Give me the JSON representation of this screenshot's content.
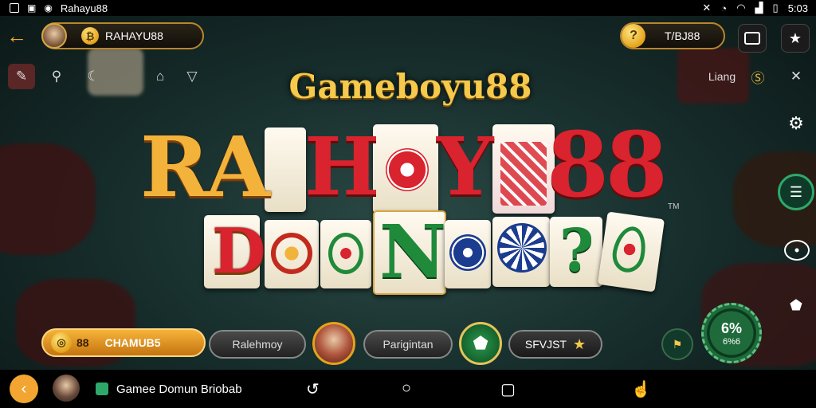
{
  "status": {
    "app_label": "Rahayu88",
    "time": "5:03"
  },
  "header": {
    "account_name": "RAHAYU88",
    "coin_symbol": "₿",
    "balance": "T/BJ88"
  },
  "toolbar": {
    "lang_label": "Liang"
  },
  "logo": {
    "top_title": "Gameboyu88",
    "row1_left": "RA",
    "row1_mid": "H",
    "row1_y": "Y",
    "row1_num": "88",
    "tm": "TM",
    "row2_d": "D",
    "row2_n": "N",
    "row2_q": "?"
  },
  "bottom": {
    "main_btn": "CHAMUB5",
    "main_num": "88",
    "btn2": "Ralehmoy",
    "btn3": "Parigintan",
    "btn4": "SFVJST",
    "chip_top": "6%",
    "chip_bottom": "6%6"
  },
  "navbar": {
    "app_title": "Gamee Domun Briobab"
  },
  "colors": {
    "accent": "#f2a531",
    "gold_border": "#b8862e",
    "felt": "#18302e",
    "green_chip": "#1f6a3a"
  }
}
